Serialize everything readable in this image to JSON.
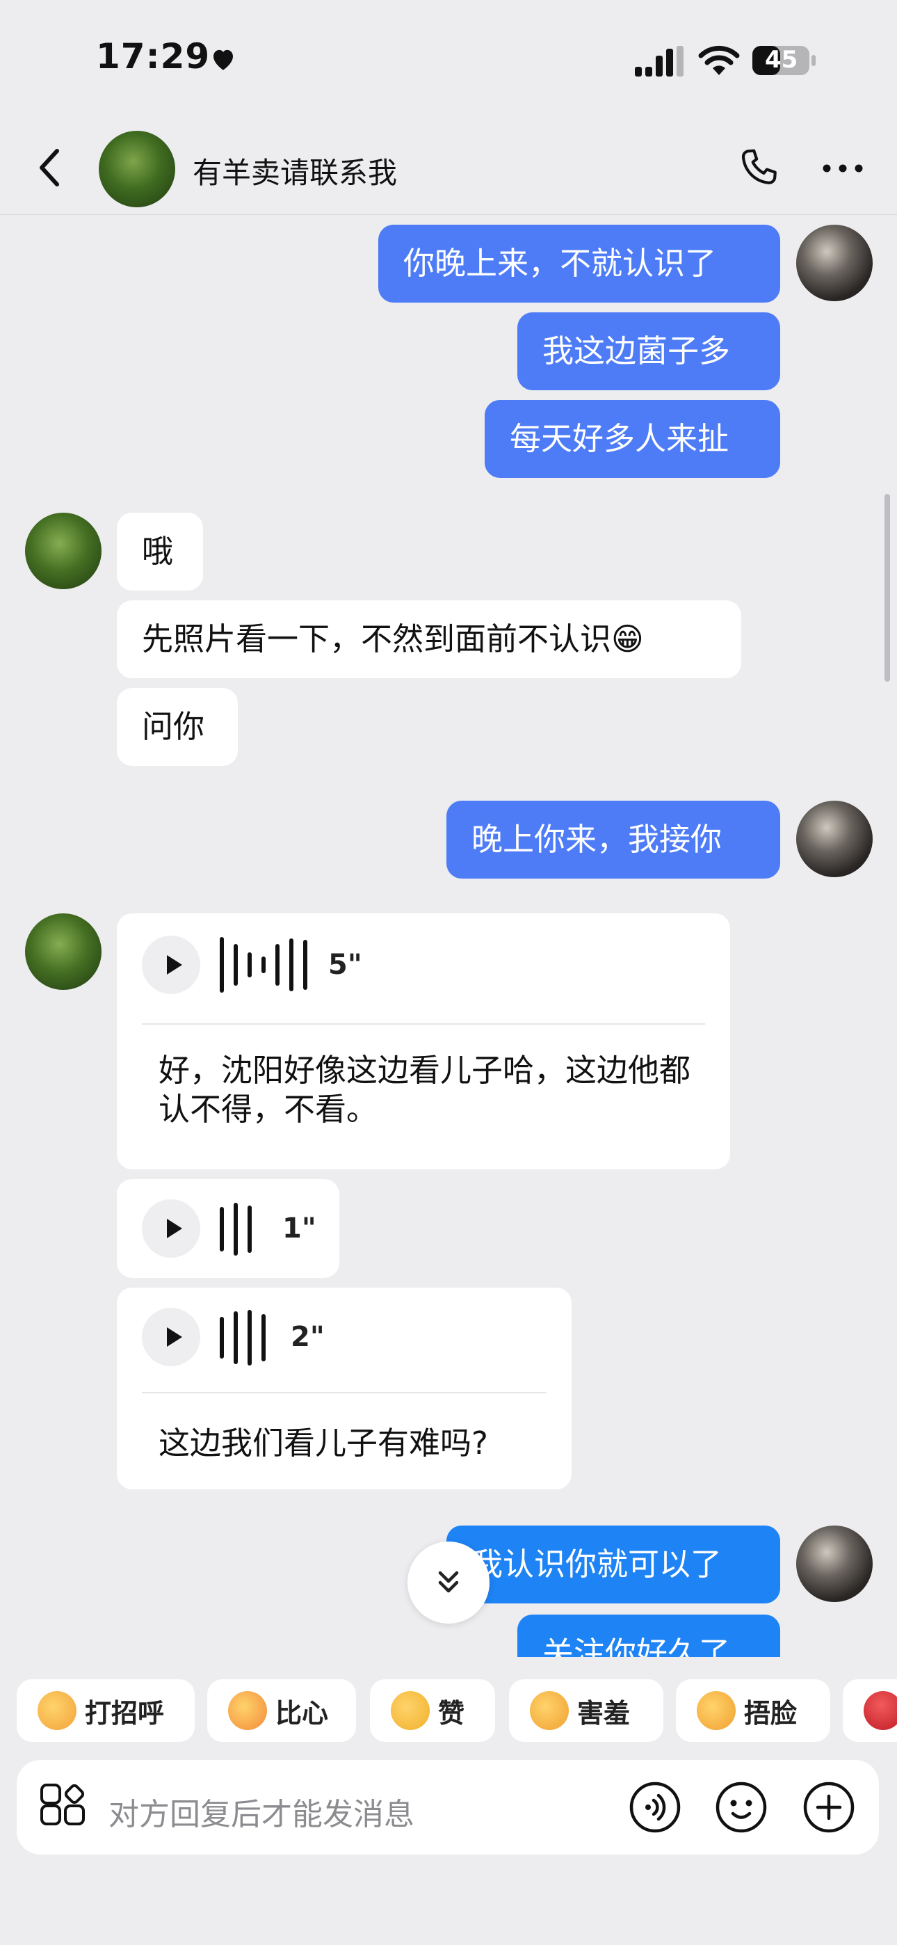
{
  "status": {
    "time": "17:29",
    "battery": "45"
  },
  "header": {
    "title": "有羊卖请联系我"
  },
  "messages": {
    "m1": "你晚上来，不就认识了",
    "m2": "我这边菌子多",
    "m3": "每天好多人来扯",
    "m4": "哦",
    "m5": "先照片看一下，不然到面前不认识😁",
    "m6": "问你",
    "m7": "晚上你来，我接你",
    "v1_duration": "5\"",
    "v1_text": "好，沈阳好像这边看儿子哈，这边他都认不得，不看。",
    "v2_duration": "1\"",
    "v3_duration": "2\"",
    "v3_text": "这边我们看儿子有难吗?",
    "m8": "我认识你就可以了",
    "m9": "关注你好久了"
  },
  "quick_replies": [
    "打招呼",
    "比心",
    "赞",
    "害羞",
    "捂脸"
  ],
  "input": {
    "placeholder": "对方回复后才能发消息"
  },
  "colors": {
    "outgoing": "#4e7cf6",
    "outgoing_alt": "#1e83f4",
    "incoming": "#ffffff",
    "background": "#ededf0"
  }
}
